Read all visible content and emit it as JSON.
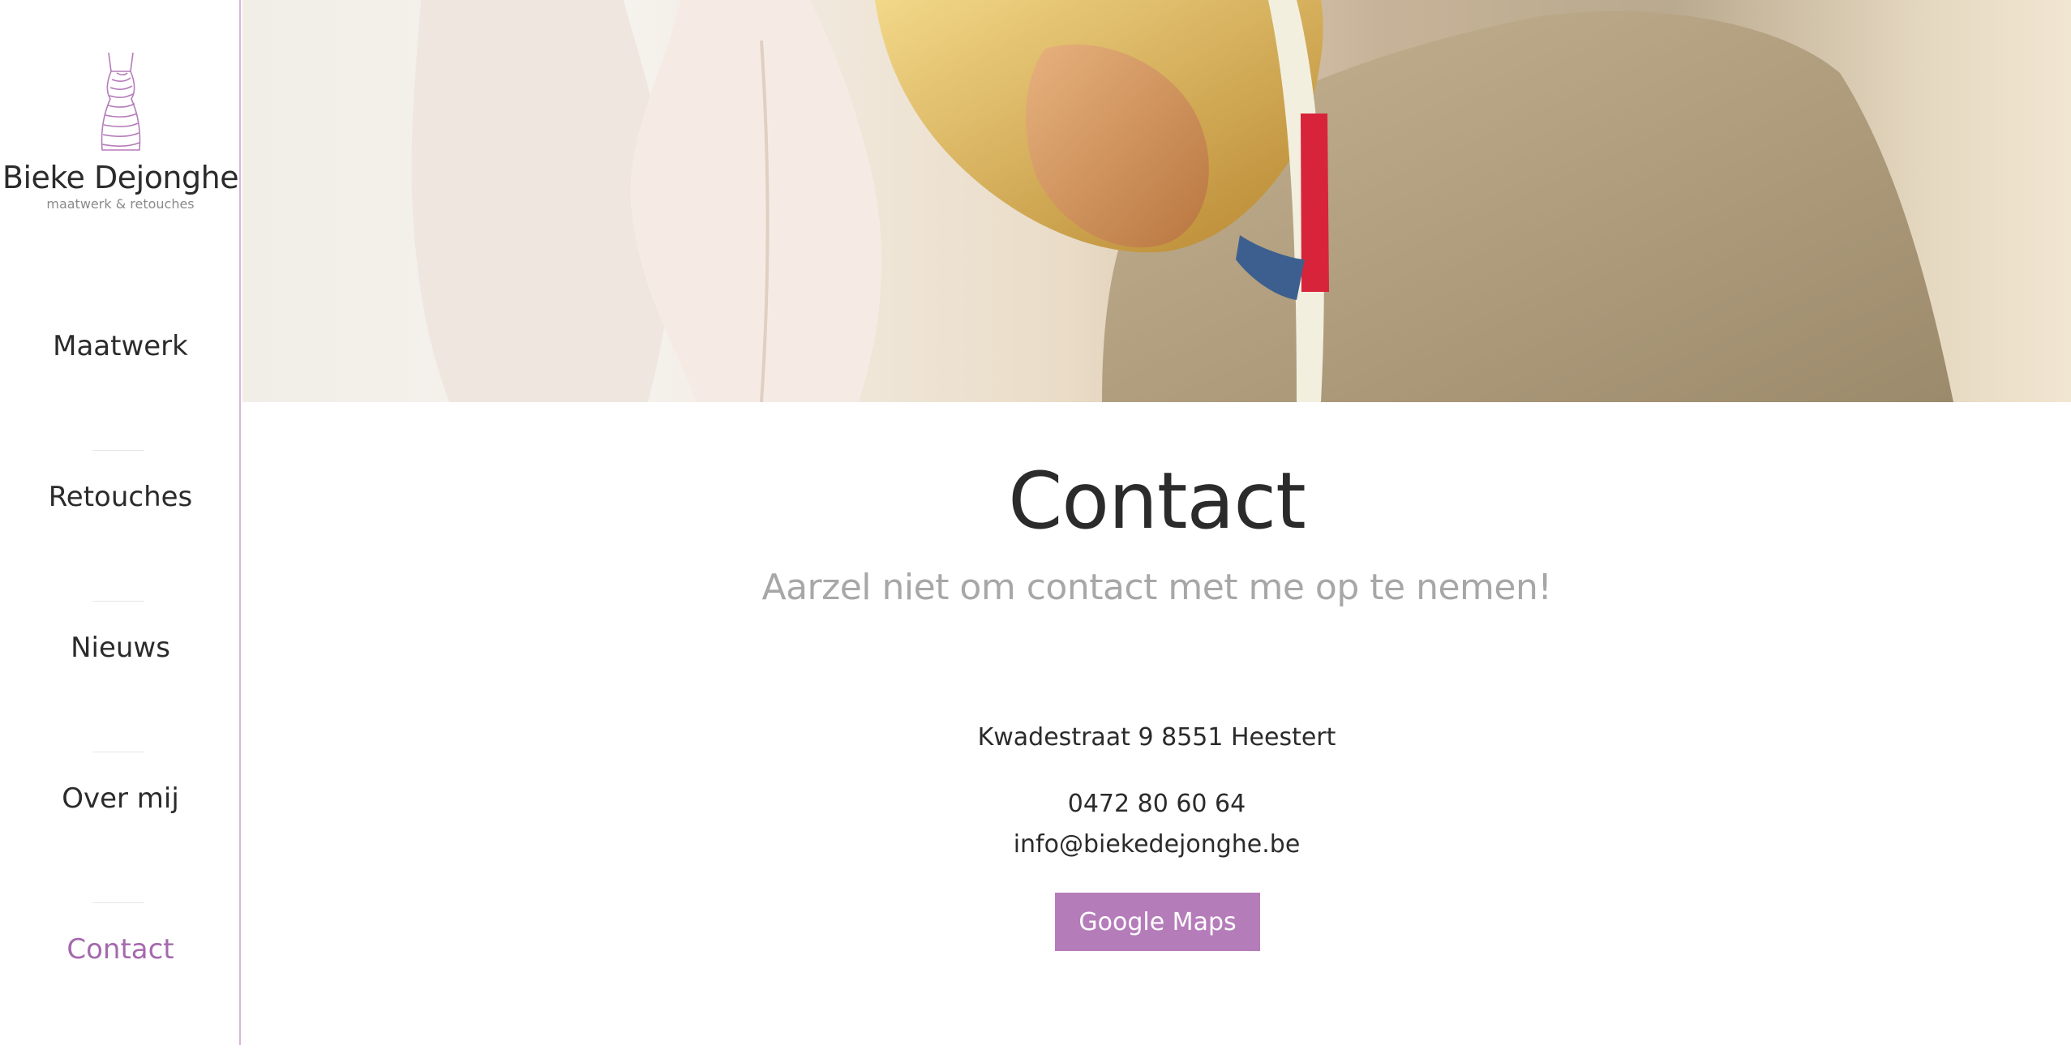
{
  "brand": {
    "name": "Bieke Dejonghe",
    "tagline": "maatwerk & retouches"
  },
  "nav": {
    "items": [
      {
        "label": "Maatwerk",
        "active": false
      },
      {
        "label": "Retouches",
        "active": false
      },
      {
        "label": "Nieuws",
        "active": false
      },
      {
        "label": "Over mij",
        "active": false
      },
      {
        "label": "Contact",
        "active": true
      }
    ]
  },
  "page": {
    "title": "Contact",
    "subtitle": "Aarzel niet om contact met me op te nemen!"
  },
  "contact": {
    "address": "Kwadestraat 9 8551 Heestert",
    "phone": "0472 80 60 64",
    "email": "info@biekedejonghe.be",
    "maps_button": "Google Maps"
  },
  "colors": {
    "accent": "#b57cba",
    "active_nav": "#a569ae",
    "sidebar_border": "#d9b6dc",
    "subtitle": "#a7a7a7",
    "text": "#2b2b2b"
  }
}
